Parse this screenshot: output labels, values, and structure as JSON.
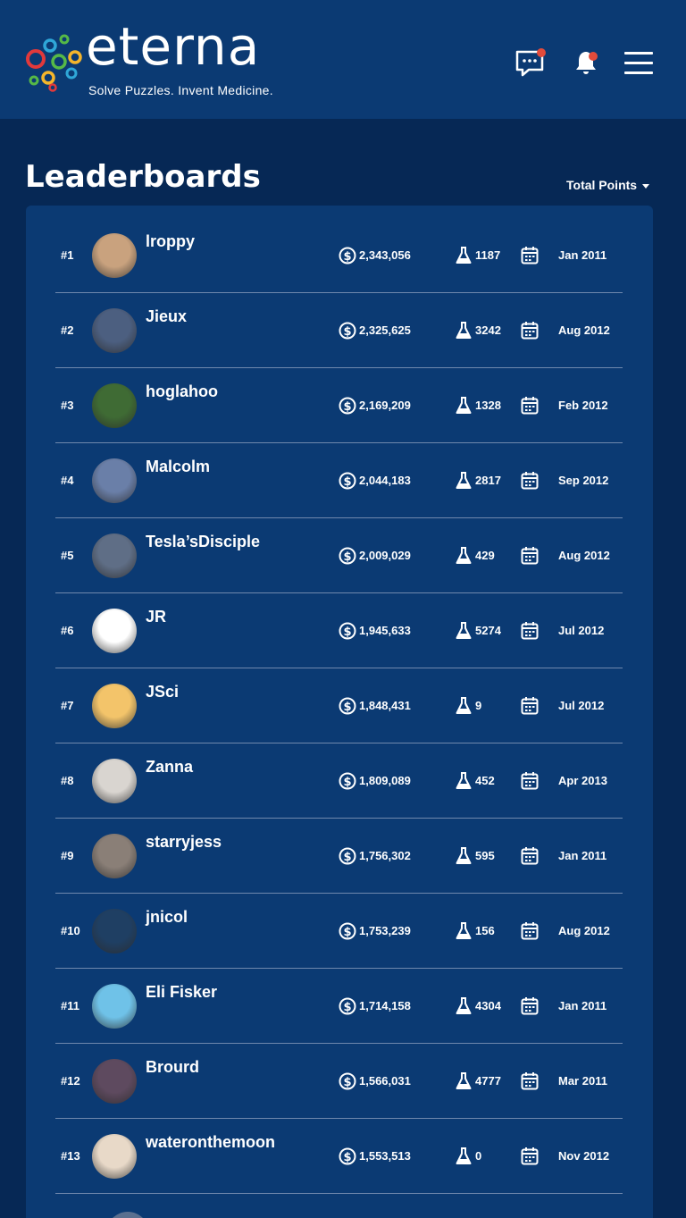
{
  "header": {
    "logo_word": "eterna",
    "tagline": "Solve Puzzles. Invent Medicine.",
    "notification_color": "#e24b3b",
    "icons": [
      "chat-icon",
      "bell-icon",
      "hamburger-menu-icon"
    ]
  },
  "page": {
    "title": "Leaderboards",
    "sort_label": "Total Points"
  },
  "leaders": [
    {
      "rank": "#1",
      "name": "lroppy",
      "points": "2,343,056",
      "labs": "1187",
      "joined": "Jan 2011",
      "avatar_color": "#c9a27e"
    },
    {
      "rank": "#2",
      "name": "Jieux",
      "points": "2,325,625",
      "labs": "3242",
      "joined": "Aug 2012",
      "avatar_color": "#4c5f80"
    },
    {
      "rank": "#3",
      "name": "hoglahoo",
      "points": "2,169,209",
      "labs": "1328",
      "joined": "Feb 2012",
      "avatar_color": "#3f6b34"
    },
    {
      "rank": "#4",
      "name": "Malcolm",
      "points": "2,044,183",
      "labs": "2817",
      "joined": "Sep 2012",
      "avatar_color": "#6a7fa8"
    },
    {
      "rank": "#5",
      "name": "Tesla’sDisciple",
      "points": "2,009,029",
      "labs": "429",
      "joined": "Aug 2012",
      "avatar_color": "#5f6e86"
    },
    {
      "rank": "#6",
      "name": "JR",
      "points": "1,945,633",
      "labs": "5274",
      "joined": "Jul 2012",
      "avatar_color": "#ffffff"
    },
    {
      "rank": "#7",
      "name": "JSci",
      "points": "1,848,431",
      "labs": "9",
      "joined": "Jul 2012",
      "avatar_color": "#f3c46a"
    },
    {
      "rank": "#8",
      "name": "Zanna",
      "points": "1,809,089",
      "labs": "452",
      "joined": "Apr 2013",
      "avatar_color": "#d9d5d0"
    },
    {
      "rank": "#9",
      "name": "starryjess",
      "points": "1,756,302",
      "labs": "595",
      "joined": "Jan 2011",
      "avatar_color": "#8a7f77"
    },
    {
      "rank": "#10",
      "name": "jnicol",
      "points": "1,753,239",
      "labs": "156",
      "joined": "Aug 2012",
      "avatar_color": "#1f3f63"
    },
    {
      "rank": "#11",
      "name": "Eli Fisker",
      "points": "1,714,158",
      "labs": "4304",
      "joined": "Jan 2011",
      "avatar_color": "#6fc2e8"
    },
    {
      "rank": "#12",
      "name": "Brourd",
      "points": "1,566,031",
      "labs": "4777",
      "joined": "Mar 2011",
      "avatar_color": "#5e4a5f"
    },
    {
      "rank": "#13",
      "name": "wateronthemoon",
      "points": "1,553,513",
      "labs": "0",
      "joined": "Nov 2012",
      "avatar_color": "#e8d9c8"
    }
  ]
}
